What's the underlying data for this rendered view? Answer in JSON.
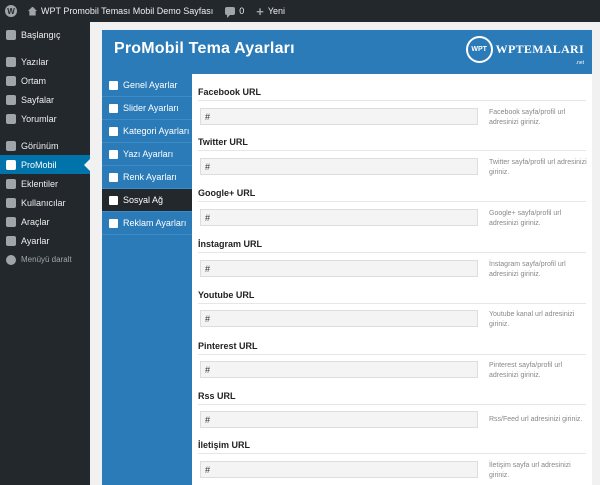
{
  "adminbar": {
    "site_name": "WPT Promobil Teması Mobil Demo Sayfası",
    "comments_count": "0",
    "new_label": "Yeni"
  },
  "sidebar": {
    "items": [
      {
        "label": "Başlangıç",
        "icon": "dashboard-icon"
      },
      {
        "label": "Yazılar",
        "icon": "pin-icon"
      },
      {
        "label": "Ortam",
        "icon": "media-icon"
      },
      {
        "label": "Sayfalar",
        "icon": "pages-icon"
      },
      {
        "label": "Yorumlar",
        "icon": "comments-icon"
      },
      {
        "label": "Görünüm",
        "icon": "appearance-icon"
      },
      {
        "label": "ProMobil",
        "icon": "mobile-icon"
      },
      {
        "label": "Eklentiler",
        "icon": "plugins-icon"
      },
      {
        "label": "Kullanıcılar",
        "icon": "users-icon"
      },
      {
        "label": "Araçlar",
        "icon": "tools-icon"
      },
      {
        "label": "Ayarlar",
        "icon": "settings-icon"
      }
    ],
    "collapse_label": "Menüyü daralt"
  },
  "panel": {
    "title": "ProMobil Tema Ayarları",
    "brand_badge": "WPT",
    "brand_text": "WPTEMALARI",
    "brand_suffix": ".net",
    "nav": [
      {
        "label": "Genel Ayarlar",
        "icon": "home-icon"
      },
      {
        "label": "Slider Ayarları",
        "icon": "slider-icon"
      },
      {
        "label": "Kategori Ayarları",
        "icon": "folder-icon"
      },
      {
        "label": "Yazı Ayarları",
        "icon": "pencil-icon"
      },
      {
        "label": "Renk Ayarları",
        "icon": "brush-icon"
      },
      {
        "label": "Sosyal Ağ",
        "icon": "facebook-icon"
      },
      {
        "label": "Reklam Ayarları",
        "icon": "document-icon"
      }
    ]
  },
  "fields": [
    {
      "title": "Facebook URL",
      "value": "#",
      "desc": "Facebook sayfa/profil url adresinizi giriniz."
    },
    {
      "title": "Twitter URL",
      "value": "#",
      "desc": "Twitter sayfa/profil url adresinizi giriniz."
    },
    {
      "title": "Google+ URL",
      "value": "#",
      "desc": "Google+ sayfa/profil url adresinizi giriniz."
    },
    {
      "title": "İnstagram URL",
      "value": "#",
      "desc": "İnstagram sayfa/profil url adresinizi giriniz."
    },
    {
      "title": "Youtube URL",
      "value": "#",
      "desc": "Youtube kanal url adresinizi giriniz."
    },
    {
      "title": "Pinterest URL",
      "value": "#",
      "desc": "Pinterest sayfa/profil url adresinizi giriniz."
    },
    {
      "title": "Rss URL",
      "value": "#",
      "desc": "Rss/Feed url adresinizi giriniz."
    },
    {
      "title": "İletişim URL",
      "value": "#",
      "desc": "İletişim sayfa url adresinizi giriniz."
    }
  ]
}
